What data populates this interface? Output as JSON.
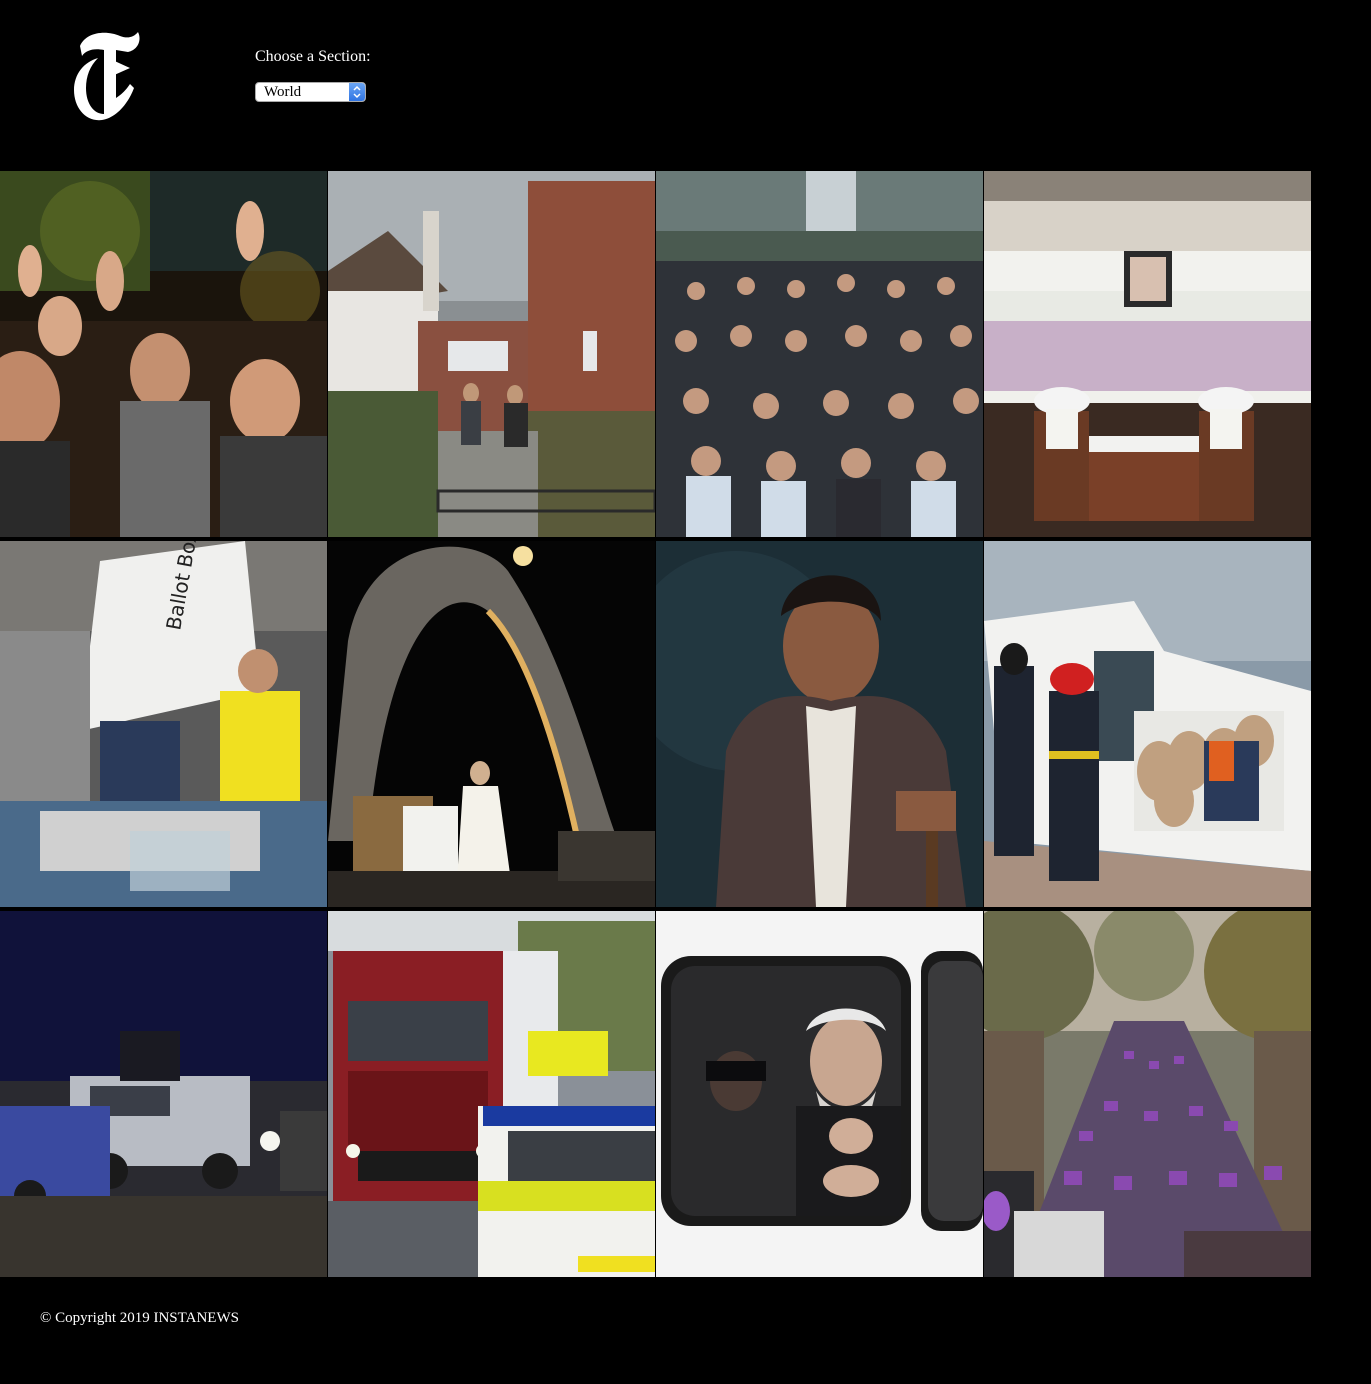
{
  "header": {
    "logo_icon": "nyt-t-logo-icon",
    "section_label": "Choose a Section:",
    "section_select": {
      "selected": "World"
    }
  },
  "stories": [
    {
      "photo": "hong-kong-celebrating-crowd-photo"
    },
    {
      "photo": "women-walking-from-brick-house-photo"
    },
    {
      "photo": "seated-crowd-by-fountain-photo"
    },
    {
      "photo": "memorial-altar-flowers-photo"
    },
    {
      "photo": "ballot-box-counting-photo"
    },
    {
      "photo": "pope-at-night-memorial-arch-photo"
    },
    {
      "photo": "seated-man-portrait-photo"
    },
    {
      "photo": "firefighters-sheep-boat-photo"
    },
    {
      "photo": "vehicles-at-night-photo"
    },
    {
      "photo": "truck-and-police-car-photo"
    },
    {
      "photo": "man-in-police-van-window-photo"
    },
    {
      "photo": "street-march-purple-signs-photo"
    }
  ],
  "footer": {
    "copyright": "© Copyright 2019 INSTANEWS"
  },
  "colors": {
    "background": "#000000",
    "text": "#ffffff",
    "select_accent": "#2f74e3"
  }
}
